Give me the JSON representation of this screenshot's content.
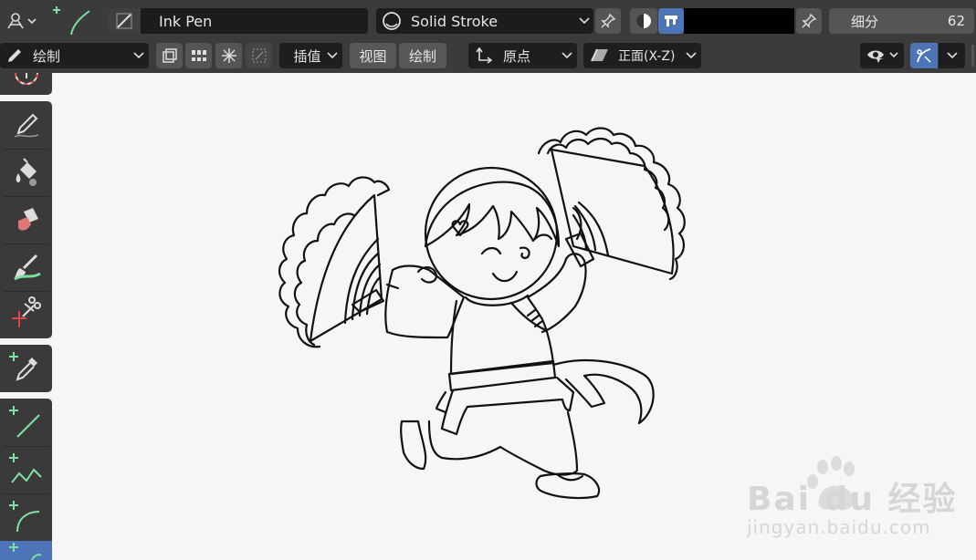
{
  "header": {
    "brush_name": "Ink Pen",
    "material_name": "Solid Stroke",
    "subdivision_label": "细分",
    "subdivision_value": "62",
    "stroke_color": "#000000"
  },
  "toolbar_row": {
    "mode_label": "绘制",
    "interpolate_label": "插值",
    "view_label": "视图",
    "draw_label": "绘制",
    "origin_label": "原点",
    "plane_label": "正面(X-Z)"
  },
  "tools": [
    {
      "name": "draw-tool",
      "icon": "pencil-icon"
    },
    {
      "name": "fill-tool",
      "icon": "paint-bucket-icon"
    },
    {
      "name": "erase-tool",
      "icon": "eraser-icon"
    },
    {
      "name": "tint-tool",
      "icon": "brush-icon"
    },
    {
      "name": "cutter-tool",
      "icon": "scissors-icon"
    },
    {
      "name": "eyedropper-tool",
      "icon": "eyedropper-icon"
    },
    {
      "name": "line-tool",
      "icon": "line-icon"
    },
    {
      "name": "polyline-tool",
      "icon": "polyline-icon"
    },
    {
      "name": "arc-tool",
      "icon": "arc-icon"
    },
    {
      "name": "curve-tool",
      "icon": "curve-icon"
    }
  ],
  "watermark": {
    "brand": "Bai du 经验",
    "url": "jingyan.baidu.com"
  },
  "colors": {
    "header_bg": "#3b3b3b",
    "field_bg": "#2a2a2a",
    "accent": "#4e74b8",
    "viewport_bg": "#f6f6f6"
  }
}
